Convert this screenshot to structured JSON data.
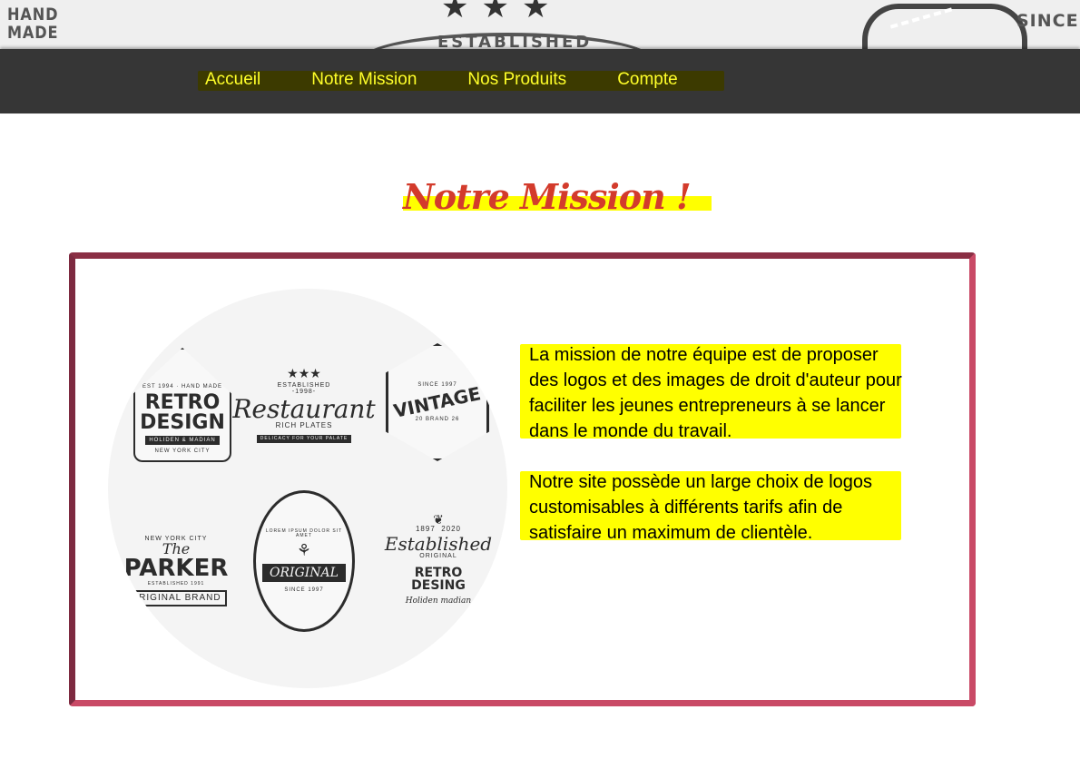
{
  "banner": {
    "left_text": "HAND\nMADE",
    "stars": "★★★",
    "center_text": "ESTABLISHED",
    "right_text": "SINCE"
  },
  "nav": {
    "items": [
      {
        "label": "Accueil"
      },
      {
        "label": "Notre Mission"
      },
      {
        "label": "Nos Produits"
      },
      {
        "label": "Compte"
      }
    ]
  },
  "page": {
    "title": "Notre Mission !"
  },
  "mission": {
    "paragraphs": [
      "La mission de notre équipe est de proposer des logos et des images de droit d'auteur pour faciliter les jeunes entrepreneurs à se lancer dans le monde du travail.",
      "Notre site possède un large choix de logos customisables à différents tarifs afin de satisfaire un maximum de clientèle."
    ]
  },
  "logos": {
    "retro": {
      "top": "EST 1994 · HAND MADE",
      "line1": "RETRO",
      "line2": "DESIGN",
      "band": "HOLIDEN & MADIAN",
      "bottom": "NEW YORK CITY"
    },
    "restaurant": {
      "stars": "★★★",
      "top": "ESTABLISHED",
      "year": "-1998-",
      "main": "Restaurant",
      "sub": "RICH PLATES",
      "bottom": "DELICACY FOR YOUR PALATE"
    },
    "vintage": {
      "top": "SINCE 1997",
      "main": "VINTAGE",
      "bottom": "20 BRAND 26"
    },
    "parker": {
      "top": "NEW YORK CITY",
      "the": "The",
      "main": "PARKER",
      "est": "ESTABLISHED 1991",
      "bottom": "ORIGINAL BRAND"
    },
    "original": {
      "ring": "LOREM IPSUM DOLOR SIT AMET",
      "main": "ORIGINAL",
      "bottom": "SINCE 1997"
    },
    "established": {
      "years": "1897  2020",
      "main": "Established",
      "sub": "ORIGINAL",
      "band": "RETRO DESING",
      "bottom": "Holiden madian"
    }
  },
  "colors": {
    "nav_bg": "#363636",
    "nav_text": "#ffff29",
    "title": "#d33b2c",
    "highlight": "#ffff00",
    "border": "#c94a66"
  }
}
